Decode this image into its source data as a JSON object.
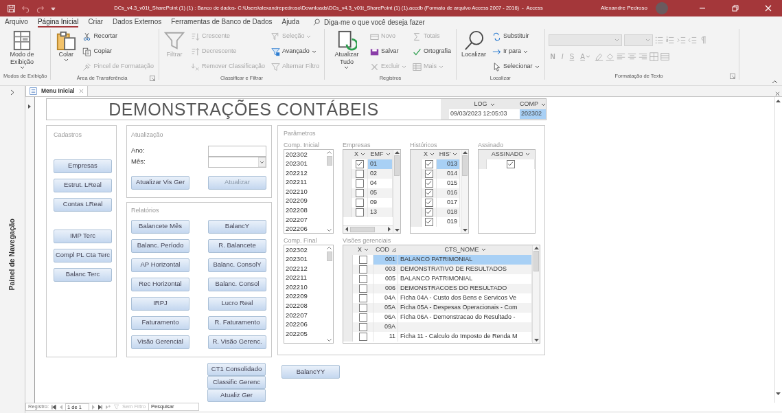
{
  "title_bar": {
    "title": "DCs_v4.3_v01t_SharePoint (1) (1) : Banco de dados- C:\\Users\\alexandrepedroso\\Downloads\\DCs_v4.3_v01t_SharePoint (1) (1).accdb (Formato de arquivo Access 2007 - 2016)  -  Access",
    "user": "Alexandre Pedroso"
  },
  "menu_tabs": [
    {
      "label": "Arquivo",
      "selected": false
    },
    {
      "label": "Página Inicial",
      "selected": true
    },
    {
      "label": "Criar",
      "selected": false
    },
    {
      "label": "Dados Externos",
      "selected": false
    },
    {
      "label": "Ferramentas de Banco de Dados",
      "selected": false
    },
    {
      "label": "Ajuda",
      "selected": false
    }
  ],
  "tell_me": {
    "placeholder": "Diga-me o que você deseja fazer"
  },
  "ribbon": [
    {
      "kind": "buttons",
      "label": "Modos de Exibição",
      "launcher": false,
      "columns": [
        [
          {
            "kind": "large",
            "label": "Modo de Exibição",
            "dropdown": true,
            "disabled": false
          }
        ]
      ]
    },
    {
      "kind": "buttons",
      "label": "Área de Transferência",
      "launcher": true,
      "columns": [
        [
          {
            "kind": "large",
            "label": "Colar",
            "dropdown": true,
            "disabled": false
          }
        ],
        [
          {
            "kind": "small",
            "label": "Recortar",
            "dropdown": false,
            "disabled": false
          },
          {
            "kind": "small",
            "label": "Copiar",
            "dropdown": false,
            "disabled": false
          },
          {
            "kind": "small",
            "label": "Pincel de Formatação",
            "dropdown": false,
            "disabled": true
          }
        ]
      ]
    },
    {
      "kind": "buttons",
      "label": "Classificar e Filtrar",
      "launcher": false,
      "columns": [
        [
          {
            "kind": "large",
            "label": "Filtrar",
            "dropdown": false,
            "disabled": true
          }
        ],
        [
          {
            "kind": "small",
            "label": "Crescente",
            "dropdown": false,
            "disabled": true
          },
          {
            "kind": "small",
            "label": "Decrescente",
            "dropdown": false,
            "disabled": true
          },
          {
            "kind": "small",
            "label": "Remover Classificação",
            "dropdown": false,
            "disabled": true
          }
        ],
        [
          {
            "kind": "small",
            "label": "Seleção",
            "dropdown": true,
            "disabled": true
          },
          {
            "kind": "small",
            "label": "Avançado",
            "dropdown": true,
            "disabled": false
          },
          {
            "kind": "small",
            "label": "Alternar Filtro",
            "dropdown": false,
            "disabled": true
          }
        ]
      ]
    },
    {
      "kind": "buttons",
      "label": "Registros",
      "launcher": false,
      "columns": [
        [
          {
            "kind": "large",
            "label": "Atualizar Tudo",
            "dropdown": true,
            "disabled": false
          }
        ],
        [
          {
            "kind": "small",
            "label": "Novo",
            "dropdown": false,
            "disabled": true
          },
          {
            "kind": "small",
            "label": "Salvar",
            "dropdown": false,
            "disabled": false
          },
          {
            "kind": "small",
            "label": "Excluir",
            "dropdown": true,
            "disabled": true
          }
        ],
        [
          {
            "kind": "small",
            "label": "Totais",
            "dropdown": false,
            "disabled": true
          },
          {
            "kind": "small",
            "label": "Ortografia",
            "dropdown": false,
            "disabled": false
          },
          {
            "kind": "small",
            "label": "Mais",
            "dropdown": true,
            "disabled": true
          }
        ]
      ]
    },
    {
      "kind": "buttons",
      "label": "Localizar",
      "launcher": false,
      "columns": [
        [
          {
            "kind": "large",
            "label": "Localizar",
            "dropdown": false,
            "disabled": false
          }
        ],
        [
          {
            "kind": "small",
            "label": "Substituir",
            "dropdown": false,
            "disabled": false
          },
          {
            "kind": "small",
            "label": "Ir para",
            "dropdown": true,
            "disabled": false
          },
          {
            "kind": "small",
            "label": "Selecionar",
            "dropdown": true,
            "disabled": false
          }
        ]
      ]
    },
    {
      "kind": "format",
      "label": "Formatação de Texto",
      "launcher": true,
      "disabled": true,
      "style_buttons": [
        "N",
        "I",
        "S"
      ],
      "font_color": "A"
    }
  ],
  "nav_pane": {
    "title": "Painel de Navegação"
  },
  "document_tab": {
    "label": "Menu Inicial"
  },
  "form": {
    "title": "DEMONSTRAÇÕES CONTÁBEIS",
    "log_grid": {
      "columns": [
        "LOG",
        "COMP"
      ],
      "cells": [
        {
          "text": "09/03/2023 12:05:03",
          "selected": false
        },
        {
          "text": "202302",
          "selected": true
        }
      ]
    },
    "cadastros": {
      "title": "Cadastros",
      "groups": [
        [
          {
            "label": "Empresas"
          },
          {
            "label": "Estrut. LReal"
          },
          {
            "label": "Contas LReal"
          }
        ],
        [
          {
            "label": "IMP Terc"
          },
          {
            "label": "Compl PL Cta Terc"
          },
          {
            "label": "Balanc Terc"
          }
        ]
      ]
    },
    "atualizacao": {
      "title": "Atualização",
      "fields": [
        {
          "label": "Ano:",
          "kind": "text"
        },
        {
          "label": "Mês:",
          "kind": "combo"
        }
      ],
      "buttons": [
        {
          "label": "Atualizar Vis Ger",
          "disabled": false
        },
        {
          "label": "Atualizar",
          "disabled": true
        }
      ]
    },
    "relatorios": {
      "title": "Relatórios",
      "buttons": [
        "Balancete Mês",
        "BalancY",
        "Balanc. Período",
        "R. Balancete",
        "AP Horizontal",
        "Balanc. ConsolY",
        "Rec Horizontal",
        "Balanc. Consol",
        "IRPJ",
        "Lucro Real",
        "Faturamento",
        "R. Faturamento",
        "Visão Gerencial",
        "R. Visão Gerenc."
      ]
    },
    "extra_buttons": [
      "CT1 Consolidado",
      "Classific Gerenc",
      "Atualiz Ger"
    ],
    "parametros": {
      "title": "Parâmetros",
      "comp_inicial": {
        "label": "Comp. Inicial",
        "items": [
          {
            "text": "202302",
            "selected": false
          },
          {
            "text": "202301",
            "selected": false
          },
          {
            "text": "202212",
            "selected": false
          },
          {
            "text": "202211",
            "selected": false
          },
          {
            "text": "202210",
            "selected": false
          },
          {
            "text": "202209",
            "selected": false
          },
          {
            "text": "202208",
            "selected": false
          },
          {
            "text": "202207",
            "selected": false
          },
          {
            "text": "202206",
            "selected": false
          }
        ]
      },
      "empresas": {
        "label": "Empresas",
        "columns": [
          "X",
          "EMF"
        ],
        "rows": [
          {
            "checked": true,
            "code": "01",
            "selected": true
          },
          {
            "checked": false,
            "code": "02",
            "selected": false
          },
          {
            "checked": false,
            "code": "04",
            "selected": false
          },
          {
            "checked": false,
            "code": "05",
            "selected": false
          },
          {
            "checked": false,
            "code": "09",
            "selected": false
          },
          {
            "checked": false,
            "code": "13",
            "selected": false
          }
        ]
      },
      "historicos": {
        "label": "Históricos",
        "columns": [
          "X",
          "HIS'"
        ],
        "rows": [
          {
            "checked": true,
            "code": "013",
            "selected": true
          },
          {
            "checked": true,
            "code": "014",
            "selected": false
          },
          {
            "checked": true,
            "code": "015",
            "selected": false
          },
          {
            "checked": true,
            "code": "016",
            "selected": false
          },
          {
            "checked": true,
            "code": "017",
            "selected": false
          },
          {
            "checked": true,
            "code": "018",
            "selected": false
          },
          {
            "checked": true,
            "code": "019",
            "selected": false
          }
        ]
      },
      "assinado": {
        "label": "Assinado",
        "columns": [
          "ASSINADO"
        ],
        "rows": [
          {
            "checked": true
          }
        ]
      },
      "comp_final": {
        "label": "Comp. Final",
        "items": [
          {
            "text": "202302",
            "selected": false
          },
          {
            "text": "202301",
            "selected": false
          },
          {
            "text": "202212",
            "selected": false
          },
          {
            "text": "202211",
            "selected": false
          },
          {
            "text": "202210",
            "selected": false
          },
          {
            "text": "202209",
            "selected": false
          },
          {
            "text": "202208",
            "selected": false
          },
          {
            "text": "202207",
            "selected": false
          },
          {
            "text": "202206",
            "selected": false
          },
          {
            "text": "202205",
            "selected": false
          }
        ]
      },
      "visoes": {
        "label": "Visões gerenciais",
        "columns": [
          "X",
          "COD",
          "CTS_NOME"
        ],
        "rows": [
          {
            "checked": false,
            "cod": "001",
            "nome": "BALANCO PATRIMONIAL",
            "selected": true
          },
          {
            "checked": false,
            "cod": "003",
            "nome": "DEMONSTRATIVO DE RESULTADOS",
            "selected": false
          },
          {
            "checked": false,
            "cod": "005",
            "nome": "BALANCO PATRIMONIAL",
            "selected": false
          },
          {
            "checked": false,
            "cod": "006",
            "nome": "DEMONSTRACOES DO RESULTADO",
            "selected": false
          },
          {
            "checked": false,
            "cod": "04A",
            "nome": "Ficha 04A - Custo dos Bens e Servicos Ve",
            "selected": false
          },
          {
            "checked": false,
            "cod": "05A",
            "nome": "Ficha 05A - Despesas Operacionais - Com",
            "selected": false
          },
          {
            "checked": false,
            "cod": "06A",
            "nome": "Ficha 06A - Demonstracao do Resultado -",
            "selected": false
          },
          {
            "checked": false,
            "cod": "09A",
            "selected": false
          },
          {
            "checked": false,
            "cod": "11",
            "nome": "Ficha 11 - Calculo do Imposto de Renda M",
            "selected": false
          }
        ]
      }
    },
    "balancyy": "BalancYY"
  },
  "record_nav": {
    "label": "Registro:",
    "position": "1 de 1",
    "filter": "Sem Filtro",
    "search": {
      "placeholder": "Pesquisar"
    }
  }
}
